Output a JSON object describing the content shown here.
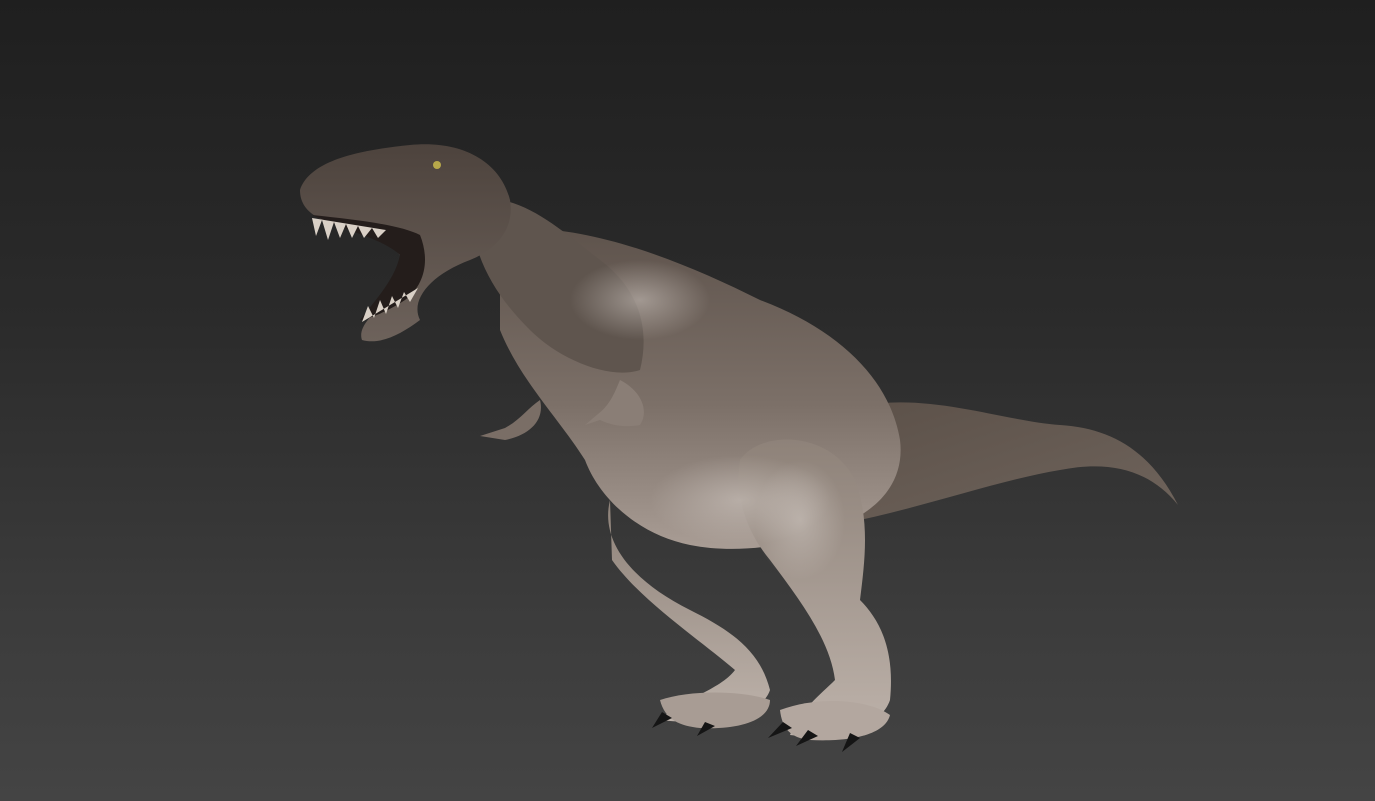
{
  "viewport": {
    "background_top": "#1f1f1f",
    "background_bottom": "#444444"
  },
  "model": {
    "subject": "tyrannosaurus-rex",
    "skin_dark": "#4a4039",
    "skin_mid": "#7a6d64",
    "skin_light": "#b8aca4",
    "claw": "#1a1a1a"
  }
}
